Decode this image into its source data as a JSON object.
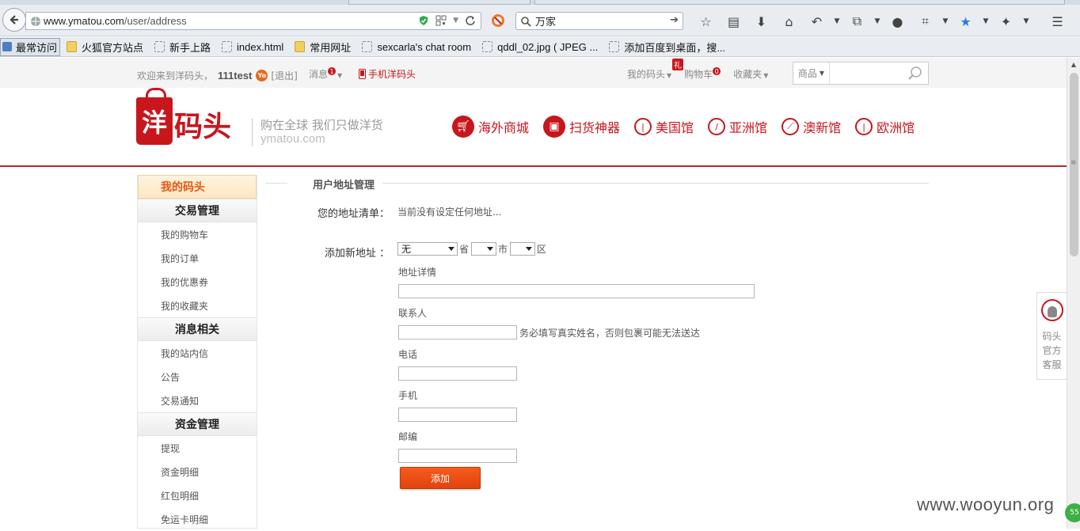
{
  "browser": {
    "url_host": "www.ymatou.com",
    "url_path": "/user/address",
    "search_query": "万家",
    "bookmarks": [
      "最常访问",
      "火狐官方站点",
      "新手上路",
      "index.html",
      "常用网址",
      "sexcarla's chat room",
      "qddl_02.jpg ( JPEG ...",
      "添加百度到桌面，搜..."
    ]
  },
  "topbar": {
    "welcome": "欢迎来到洋码头，",
    "username": "111test",
    "logout": "[退出]",
    "messages": "消息",
    "messages_count": "1",
    "mobile": "手机洋码头",
    "my_ymatou": "我的码头",
    "gift_badge": "礼",
    "cart": "购物车",
    "cart_count": "0",
    "favorites": "收藏夹",
    "search_category": "商品",
    "search_placeholder": ""
  },
  "header": {
    "logo_char": "洋",
    "logo_text": "码头",
    "slogan": "购在全球 我们只做洋货",
    "domain": "ymatou.com",
    "nav": [
      "海外商城",
      "扫货神器",
      "美国馆",
      "亚洲馆",
      "澳新馆",
      "欧洲馆"
    ]
  },
  "sidebar": {
    "top": "我的码头",
    "sections": [
      {
        "title": "交易管理",
        "links": [
          "我的购物车",
          "我的订单",
          "我的优惠券",
          "我的收藏夹"
        ]
      },
      {
        "title": "消息相关",
        "links": [
          "我的站内信",
          "公告",
          "交易通知"
        ]
      },
      {
        "title": "资金管理",
        "links": [
          "提现",
          "资金明细",
          "红包明细",
          "免运卡明细"
        ]
      }
    ]
  },
  "main": {
    "title": "用户地址管理",
    "list_label": "您的地址清单：",
    "list_empty": "当前没有设定任何地址...",
    "add_label": "添加新地址 ：",
    "province_value": "无",
    "province_unit": "省",
    "city_unit": "市",
    "district_unit": "区",
    "detail_label": "地址详情",
    "contact_label": "联系人",
    "contact_hint": "务必填写真实姓名，否则包裹可能无法送达",
    "phone_label": "电话",
    "mobile_label": "手机",
    "zip_label": "邮编",
    "add_button": "添加"
  },
  "service": {
    "lines": [
      "码头",
      "官方",
      "客服"
    ]
  },
  "watermark": "www.wooyun.org",
  "corner_badge": "55",
  "colors": {
    "brand_red": "#c8161d",
    "accent_orange": "#e8550e"
  }
}
